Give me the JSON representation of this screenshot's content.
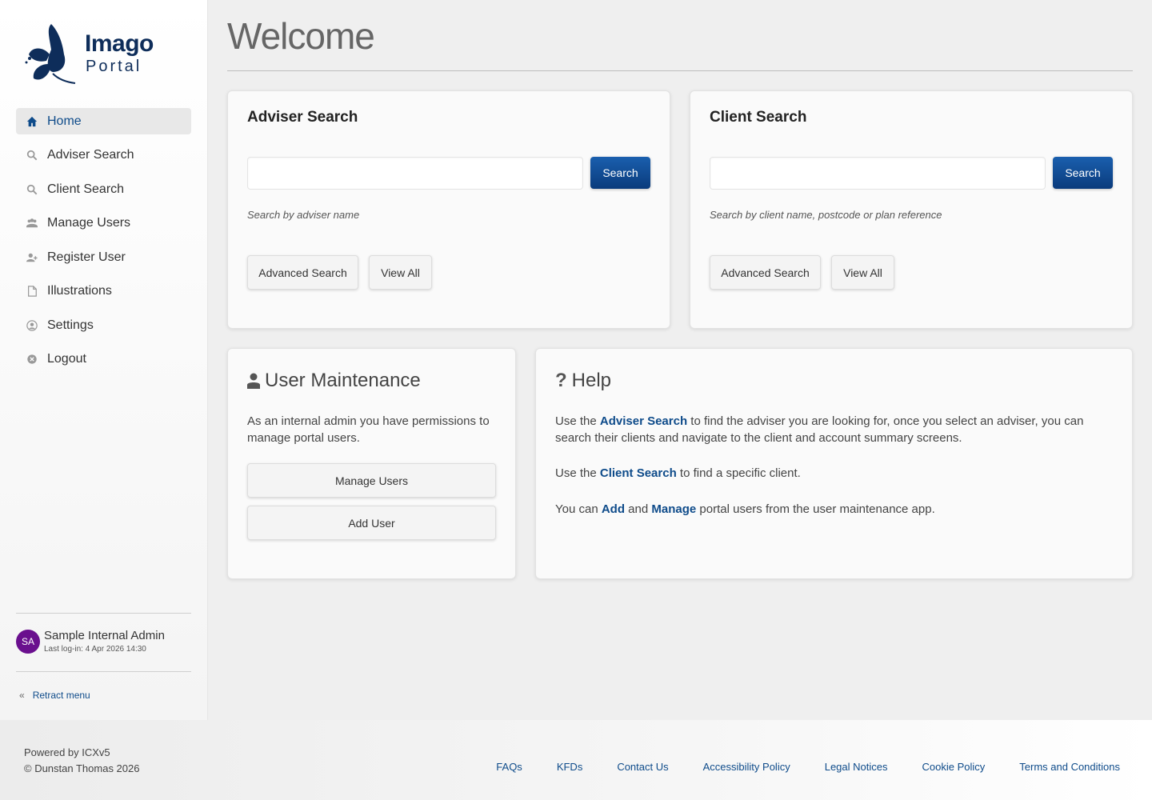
{
  "app": {
    "logo_name": "Imago",
    "logo_sub": "Portal"
  },
  "sidebar": {
    "items": [
      {
        "label": "Home",
        "icon": "home-icon",
        "active": true
      },
      {
        "label": "Adviser Search",
        "icon": "search-icon"
      },
      {
        "label": "Client Search",
        "icon": "search-icon"
      },
      {
        "label": "Manage Users",
        "icon": "users-icon"
      },
      {
        "label": "Register User",
        "icon": "user-plus-icon"
      },
      {
        "label": "Illustrations",
        "icon": "file-icon"
      },
      {
        "label": "Settings",
        "icon": "user-circle-icon"
      },
      {
        "label": "Logout",
        "icon": "close-circle-icon"
      }
    ],
    "user": {
      "initials": "SA",
      "name": "Sample Internal Admin",
      "last_login": "Last log-in: 4 Apr 2026 14:30"
    },
    "retract_label": "Retract menu"
  },
  "main": {
    "title": "Welcome",
    "adviser_search": {
      "title": "Adviser Search",
      "input_value": "",
      "search_label": "Search",
      "helper": "Search by adviser name",
      "advanced_label": "Advanced Search",
      "view_all_label": "View All"
    },
    "client_search": {
      "title": "Client Search",
      "input_value": "",
      "search_label": "Search",
      "helper": "Search by client name, postcode or plan reference",
      "advanced_label": "Advanced Search",
      "view_all_label": "View All"
    },
    "user_maintenance": {
      "title": "User Maintenance",
      "text": "As an internal admin you have permissions to manage portal users.",
      "manage_label": "Manage Users",
      "add_label": "Add User"
    },
    "help": {
      "title": "Help",
      "p1_pre": "Use the ",
      "p1_link": "Adviser Search",
      "p1_post": " to find the adviser you are looking for, once you select an adviser, you can search their clients and navigate to the client and account summary screens.",
      "p2_pre": "Use the ",
      "p2_link": "Client Search",
      "p2_post": " to find a specific client.",
      "p3_pre": "You can ",
      "p3_link1": "Add",
      "p3_mid": " and ",
      "p3_link2": "Manage",
      "p3_post": " portal users from the user maintenance app."
    }
  },
  "footer": {
    "powered": "Powered by ICXv5",
    "copyright": "© Dunstan Thomas 2026",
    "links": [
      "FAQs",
      "KFDs",
      "Contact Us",
      "Accessibility Policy",
      "Legal Notices",
      "Cookie Policy",
      "Terms and Conditions"
    ]
  },
  "colors": {
    "brand": "#0e2d5a",
    "link": "#0e4b8a",
    "primary_button": "#0a3b7c",
    "avatar": "#6a0f8e"
  }
}
